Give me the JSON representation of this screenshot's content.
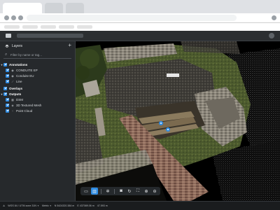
{
  "panel": {
    "title": "Layers",
    "add_icon": "plus-icon",
    "search_placeholder": "Filter by name or tag..."
  },
  "tree": {
    "annotations": {
      "label": "Annotations",
      "items": [
        {
          "label": "CONDUITE EP",
          "icon": "point-marker-icon"
        },
        {
          "label": "Conduite EU",
          "icon": "point-marker-icon"
        },
        {
          "label": "Line",
          "icon": "line-icon"
        }
      ]
    },
    "overlays": {
      "label": "Overlays"
    },
    "outputs": {
      "label": "Outputs",
      "items": [
        {
          "label": "DSM",
          "icon": "dsm-icon"
        },
        {
          "label": "3D Textured Mesh",
          "icon": "mesh-icon"
        },
        {
          "label": "Point Cloud",
          "icon": "point-cloud-icon"
        }
      ]
    }
  },
  "toolbar": {
    "icons": [
      "layers-split-icon",
      "layers-icon",
      "settings-icon",
      "camera-icon",
      "rotate-icon",
      "fit-view-icon",
      "zoom-in-icon",
      "zoom-out-icon"
    ]
  },
  "status": {
    "projection": "WGS 84 / UTM zone 31N",
    "units": "Metric",
    "coord_lat": "N 5424320.384 m",
    "coord_lon": "E 437089.06 m",
    "coord_alt": "47.593 m"
  },
  "colors": {
    "accent": "#2f8de4",
    "sidebar_bg": "#26292c",
    "app_bg": "#1e2022"
  }
}
